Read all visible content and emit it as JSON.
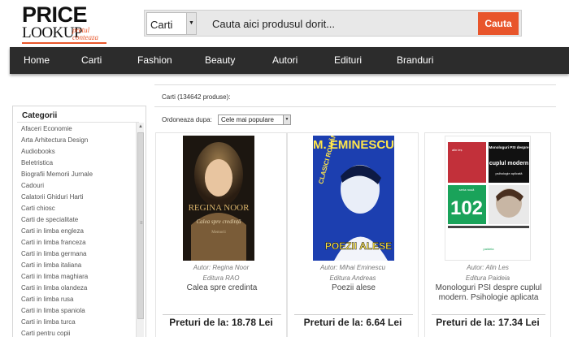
{
  "logo": {
    "line1": "PRICE",
    "line2": "LOOKUP",
    "tagline": "pretul conteaza"
  },
  "search": {
    "category_selected": "Carti",
    "placeholder": "Cauta aici produsul dorit...",
    "button_label": "Cauta"
  },
  "nav": [
    "Home",
    "Carti",
    "Fashion",
    "Beauty",
    "Autori",
    "Edituri",
    "Branduri"
  ],
  "sidebar": {
    "title": "Categorii",
    "items": [
      "Afaceri Economie",
      "Arta Arhitectura Design",
      "Audiobooks",
      "Beletristica",
      "Biografii Memorii Jurnale",
      "Cadouri",
      "Calatorii Ghiduri Harti",
      "Carti chiosc",
      "Carti de specialitate",
      "Carti in limba engleza",
      "Carti in limba franceza",
      "Carti in limba germana",
      "Carti in limba italiana",
      "Carti in limba maghiara",
      "Carti in limba olandeza",
      "Carti in limba rusa",
      "Carti in limba spaniola",
      "Carti in limba turca",
      "Carti pentru copii"
    ]
  },
  "results": {
    "label": "Carti (134642 produse):"
  },
  "sort": {
    "label": "Ordoneaza dupa:",
    "selected": "Cele mai populare"
  },
  "products": [
    {
      "author_label": "Autor:",
      "author": "Regina Noor",
      "publisher": "Editura RAO",
      "title": "Calea spre credinta",
      "price": "Preturi de la: 18.78 Lei",
      "cover": {
        "author_text": "REGINA NOOR",
        "title_text": "Calea spre credință",
        "subtitle_text": "Memorii"
      }
    },
    {
      "author_label": "Autor:",
      "author": "Mihai Eminescu",
      "publisher": "Editura Andreas",
      "title": "Poezii alese",
      "price": "Preturi de la: 6.64 Lei",
      "cover": {
        "author_text": "M. EMINESCU",
        "series_text": "CLASICI ROMÂNI",
        "title_text": "POEZII ALESE"
      }
    },
    {
      "author_label": "Autor:",
      "author": "Alin Les",
      "publisher": "Editura Paideia",
      "title": "Monologuri PSI despre cuplul modern. Psihologie aplicata",
      "price": "Preturi de la: 17.34 Lei",
      "cover": {
        "author_text": "alin leș",
        "heading_small": "Monologuri PSI despre",
        "heading_big": "cuplul modern",
        "heading_sub": "psihologie aplicată",
        "series_label": "seria nouă",
        "series_number": "102",
        "publisher_text": "paideia"
      }
    }
  ],
  "colors": {
    "accent": "#e8552b",
    "nav_bg": "#2c2c2c"
  }
}
